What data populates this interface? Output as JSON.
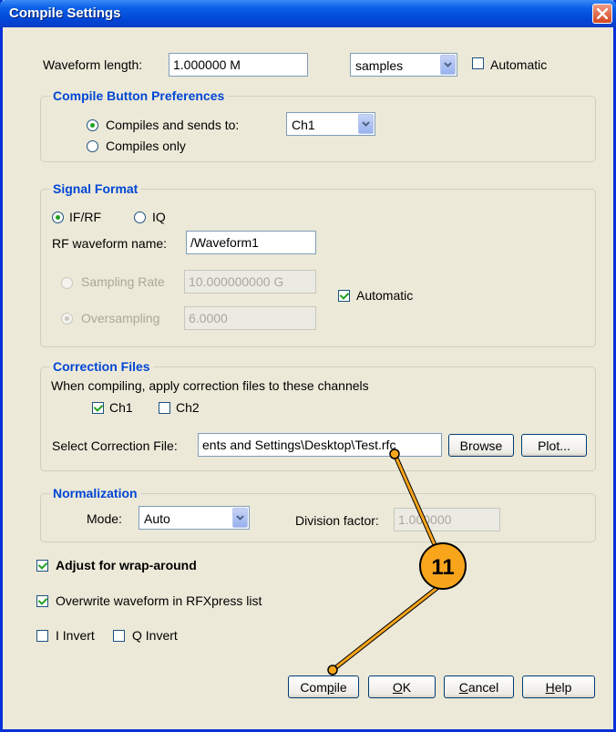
{
  "window": {
    "title": "Compile Settings"
  },
  "waveform": {
    "length_label": "Waveform length:",
    "length_value": "1.000000 M",
    "units_value": "samples",
    "automatic_label": "Automatic",
    "automatic_checked": false
  },
  "compile_prefs": {
    "title": "Compile Button Preferences",
    "option1_label": "Compiles and sends to:",
    "channel_value": "Ch1",
    "option2_label": "Compiles only"
  },
  "signal_format": {
    "title": "Signal Format",
    "ifrf_label": "IF/RF",
    "iq_label": "IQ",
    "rf_name_label": "RF waveform name:",
    "rf_name_value": "/Waveform1",
    "sampling_rate_label": "Sampling Rate",
    "sampling_rate_value": "10.000000000 G",
    "oversampling_label": "Oversampling",
    "oversampling_value": "6.0000",
    "automatic_label": "Automatic"
  },
  "correction_files": {
    "title": "Correction Files",
    "description": "When compiling, apply correction files to these channels",
    "ch1_label": "Ch1",
    "ch2_label": "Ch2",
    "select_label": "Select Correction File:",
    "file_value": "ents and Settings\\Desktop\\Test.rfc",
    "browse_label": "Browse",
    "plot_label": "Plot..."
  },
  "normalization": {
    "title": "Normalization",
    "mode_label": "Mode:",
    "mode_value": "Auto",
    "division_label": "Division factor:",
    "division_value": "1.000000"
  },
  "options": {
    "wrap_label": "Adjust for wrap-around",
    "overwrite_label": "Overwrite waveform in RFXpress list",
    "i_invert_label": "I Invert",
    "q_invert_label": "Q Invert"
  },
  "buttons": {
    "compile_pre": "Com",
    "compile_acc": "p",
    "compile_post": "ile",
    "ok_acc": "O",
    "ok_post": "K",
    "cancel_acc": "C",
    "cancel_post": "ancel",
    "help_acc": "H",
    "help_post": "elp"
  },
  "callout": {
    "number": "11"
  },
  "colors": {
    "title_bar": "#0A5FE6",
    "group_title": "#0046D5",
    "callout_fill": "#F8A51C",
    "check_mark": "#21A121"
  }
}
